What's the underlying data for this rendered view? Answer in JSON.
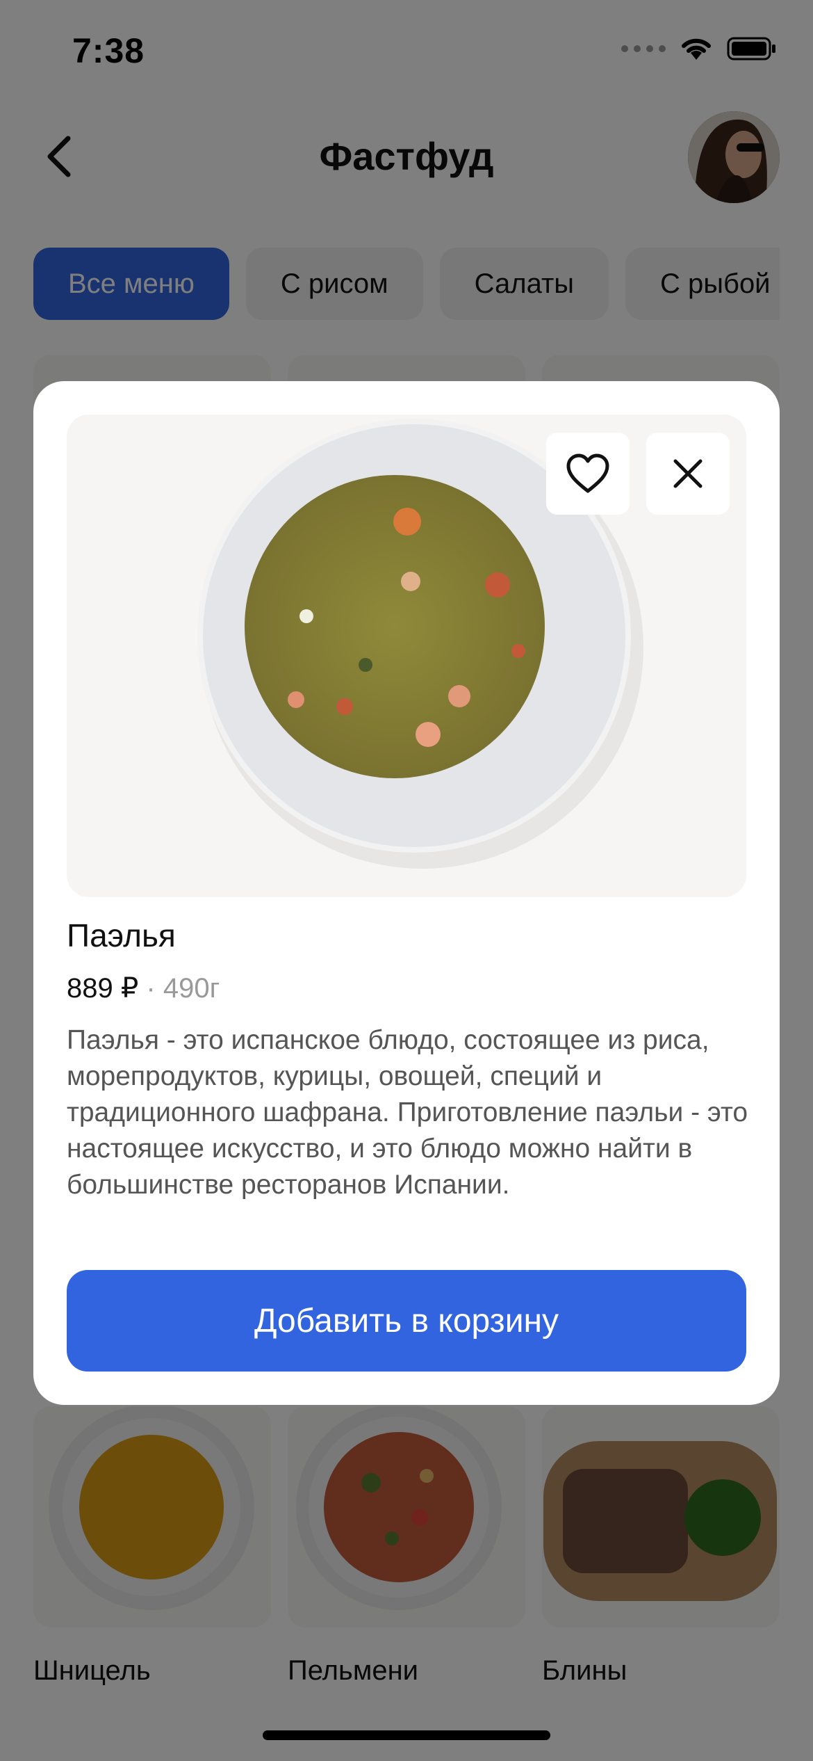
{
  "status_bar": {
    "time": "7:38"
  },
  "header": {
    "title": "Фастфуд"
  },
  "categories": [
    {
      "label": "Все меню",
      "active": true
    },
    {
      "label": "С рисом",
      "active": false
    },
    {
      "label": "Салаты",
      "active": false
    },
    {
      "label": "С рыбой",
      "active": false
    }
  ],
  "menu_items": [
    {
      "name": "Шницель"
    },
    {
      "name": "Пельмени"
    },
    {
      "name": "Блины"
    }
  ],
  "dish": {
    "name": "Паэлья",
    "price": "889 ₽",
    "separator": " · ",
    "weight": "490г",
    "description": "Паэлья - это испанское блюдо, состоящее из риса, морепродуктов, курицы, овощей, специй и традиционного шафрана. Приготовление паэльи - это настоящее искусство, и это блюдо можно найти в большинстве ресторанов Испании.",
    "add_to_cart": "Добавить в корзину"
  },
  "colors": {
    "accent": "#3364e0",
    "overlay": "rgba(0,0,0,0.5)"
  },
  "icons": [
    "back-icon",
    "heart-icon",
    "close-icon",
    "wifi-icon",
    "battery-icon"
  ]
}
